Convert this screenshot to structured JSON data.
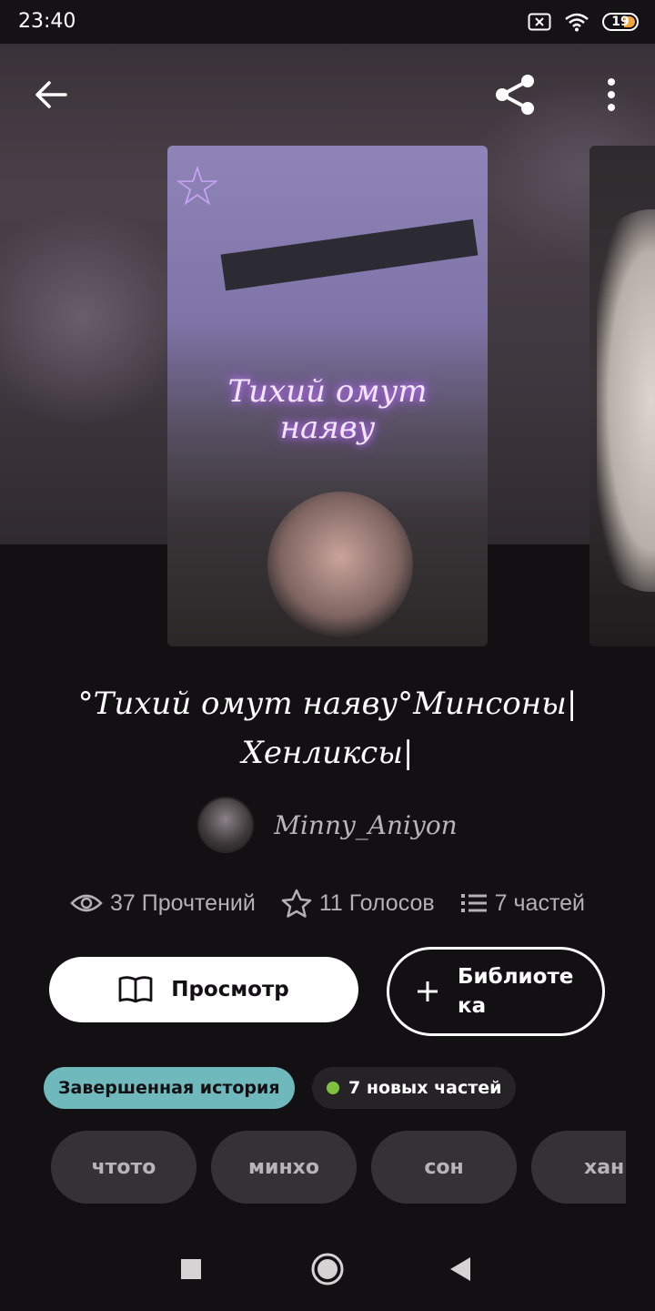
{
  "status_bar": {
    "time": "23:40",
    "battery": "19"
  },
  "cover": {
    "title_line1": "Тихий омут",
    "title_line2": "наяву"
  },
  "story": {
    "title": "°Тихий омут наяву°Минсоны| Хенликсы|",
    "author": "Minny_Aniyon"
  },
  "stats": {
    "reads": "37 Прочтений",
    "votes": "11 Голосов",
    "parts": "7 частей"
  },
  "actions": {
    "read_label": "Просмотр",
    "library_label": "Библиотека"
  },
  "badges": {
    "status": "Завершенная история",
    "new_parts": "7 новых частей",
    "new_dot_color": "#7fc13e",
    "status_color": "#6fb9bd"
  },
  "tags": [
    "чтото",
    "минхо",
    "сон",
    "хан"
  ],
  "icons": [
    "back-arrow-icon",
    "share-icon",
    "more-vert-icon",
    "eye-icon",
    "star-icon",
    "list-icon",
    "book-icon",
    "plus-icon",
    "square-icon",
    "circle-icon",
    "triangle-back-icon"
  ]
}
